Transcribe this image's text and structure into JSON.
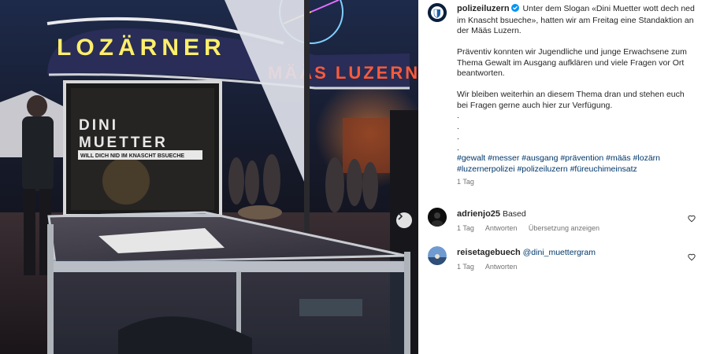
{
  "photo": {
    "neon_sign": "LOZÄRNER",
    "neon_sign_right": "MÄÄS LUZERN",
    "poster_line1": "DINI",
    "poster_line2": "MUETTER",
    "poster_line3": "WILL DICH NID IM KNASCHT BSUECHE",
    "next_icon": "chevron-right-icon"
  },
  "post": {
    "username": "polizeiluzern",
    "verified": true,
    "caption_intro": "Unter dem Slogan «Dini Muetter wott dech ned im Knascht bsueche», hatten wir am Freitag eine Standaktion an der Määs Luzern.",
    "caption_p2": "Präventiv konnten wir Jugendliche und junge Erwachsene zum Thema Gewalt im Ausgang aufklären und viele Fragen vor Ort beantworten.",
    "caption_p3": "Wir bleiben weiterhin an diesem Thema dran und stehen euch bei Fragen gerne auch hier zur Verfügung.",
    "dots": [
      ".",
      ".",
      ".",
      "."
    ],
    "hashtags": "#gewalt #messer #ausgang #prävention #määs #lozärn #luzernerpolizei #polizeiluzern #füreuchimeinsatz",
    "time": "1 Tag"
  },
  "comments": [
    {
      "username": "adrienjo25",
      "text": "Based",
      "time": "1 Tag",
      "reply_label": "Antworten",
      "translate_label": "Übersetzung anzeigen"
    },
    {
      "username": "reisetagebuech",
      "text": "@dini_muettergram",
      "time": "1 Tag",
      "reply_label": "Antworten"
    }
  ],
  "colors": {
    "link": "#00376b",
    "muted": "#737373",
    "verified": "#0095f6"
  }
}
